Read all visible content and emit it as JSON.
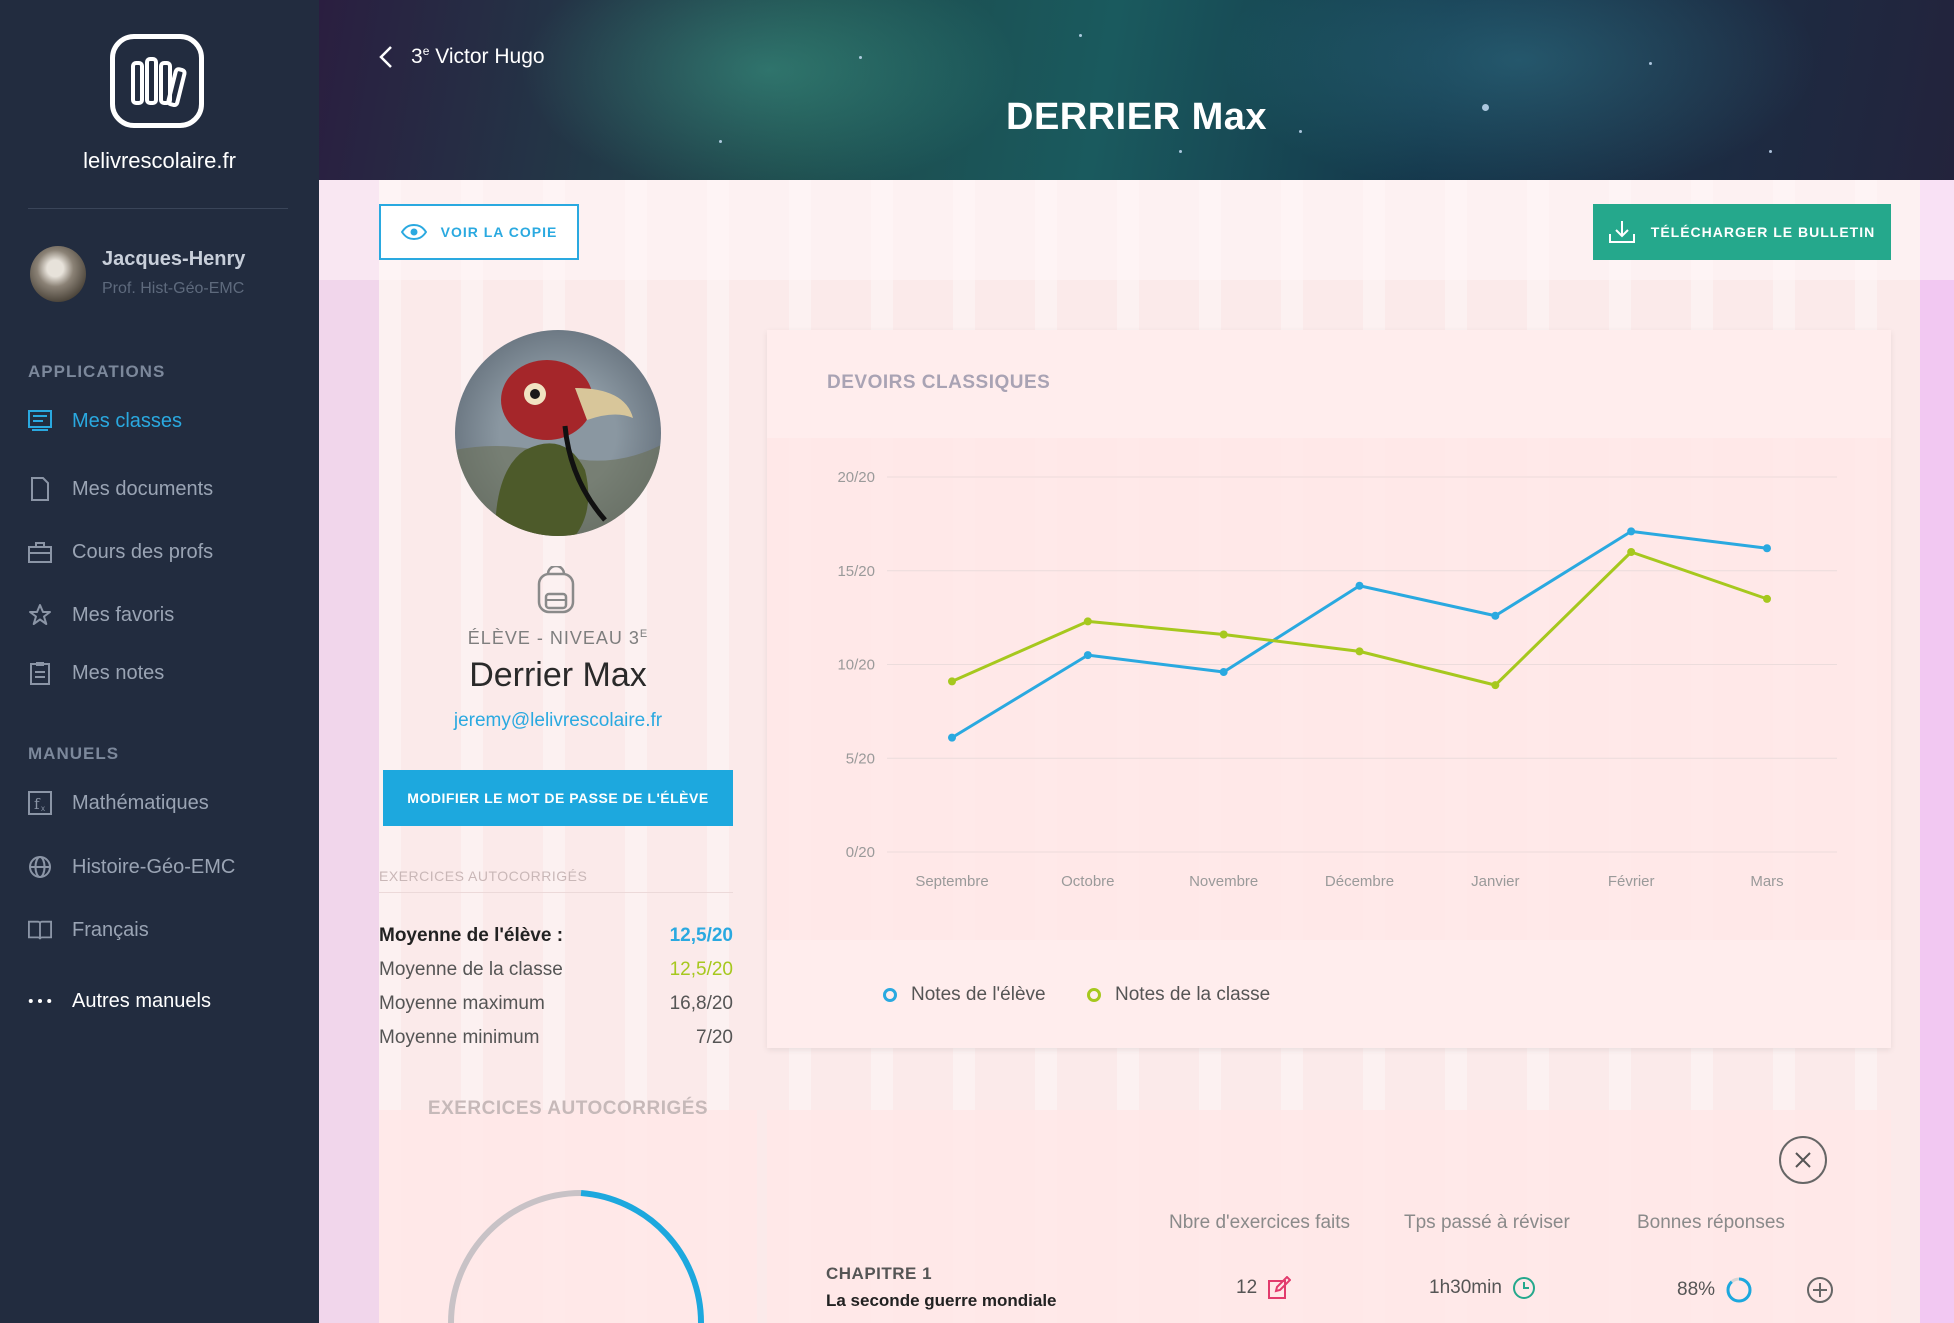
{
  "sidebar": {
    "brand": "lelivrescolaire.fr",
    "user": {
      "name": "Jacques-Henry",
      "role": "Prof. Hist-Géo-EMC"
    },
    "sections": {
      "applications": "APPLICATIONS",
      "manuels": "MANUELS"
    },
    "apps": [
      {
        "label": "Mes classes",
        "icon": "classes-icon",
        "active": true
      },
      {
        "label": "Mes documents",
        "icon": "document-icon"
      },
      {
        "label": "Cours des profs",
        "icon": "briefcase-icon"
      },
      {
        "label": "Mes favoris",
        "icon": "star-icon"
      },
      {
        "label": "Mes notes",
        "icon": "clipboard-icon"
      }
    ],
    "manuals": [
      {
        "label": "Mathématiques",
        "icon": "math-icon"
      },
      {
        "label": "Histoire-Géo-EMC",
        "icon": "globe-icon"
      },
      {
        "label": "Français",
        "icon": "book-icon"
      },
      {
        "label": "Autres manuels",
        "icon": "more-icon"
      }
    ]
  },
  "header": {
    "back_label_main": "3",
    "back_label_sup": "e",
    "back_label_rest": " Victor Hugo",
    "title": "DERRIER Max"
  },
  "actions": {
    "view_copy": "VOIR LA COPIE",
    "download": "TÉLÉCHARGER LE BULLETIN"
  },
  "student": {
    "level_main": "ÉLÈVE - NIVEAU 3",
    "level_sup": "E",
    "name": "Derrier Max",
    "email": "jeremy@lelivrescolaire.fr",
    "reset_password": "MODIFIER LE MOT DE PASSE DE L'ÉLÈVE"
  },
  "autocorrected": {
    "title": "EXERCICES AUTOCORRIGÉS",
    "stats": [
      {
        "label": "Moyenne de l'élève :",
        "value": "12,5/20",
        "color": "#2aa9e0",
        "bold": true
      },
      {
        "label": "Moyenne de la classe",
        "value": "12,5/20",
        "color": "#a6c81e"
      },
      {
        "label": "Moyenne maximum",
        "value": "16,8/20",
        "color": "#555555"
      },
      {
        "label": "Moyenne minimum",
        "value": "7/20",
        "color": "#555555"
      }
    ]
  },
  "chart_data": {
    "type": "line",
    "title": "DEVOIRS CLASSIQUES",
    "categories": [
      "Septembre",
      "Octobre",
      "Novembre",
      "Décembre",
      "Janvier",
      "Février",
      "Mars"
    ],
    "ylim": [
      0,
      20
    ],
    "yticks": [
      "20/20",
      "15/20",
      "10/20",
      "5/20",
      "0/20"
    ],
    "grid": true,
    "legend_position": "bottom-left",
    "series": [
      {
        "name": "Notes de l'élève",
        "color": "#2aa9e0",
        "values": [
          6.1,
          10.5,
          9.6,
          14.2,
          12.6,
          17.1,
          16.2
        ]
      },
      {
        "name": "Notes de la classe",
        "color": "#a6c81e",
        "values": [
          9.1,
          12.3,
          11.6,
          10.7,
          8.9,
          16.0,
          13.5
        ]
      }
    ]
  },
  "bottom": {
    "left_title": "EXERCICES AUTOCORRIGÉS",
    "columns": [
      "Nbre d'exercices faits",
      "Tps passé à réviser",
      "Bonnes réponses"
    ],
    "chapter": {
      "label": "CHAPITRE 1",
      "name": "La seconde guerre mondiale",
      "exercises": "12",
      "time": "1h30min",
      "correct": "88%",
      "correct_fraction": 0.88
    }
  }
}
